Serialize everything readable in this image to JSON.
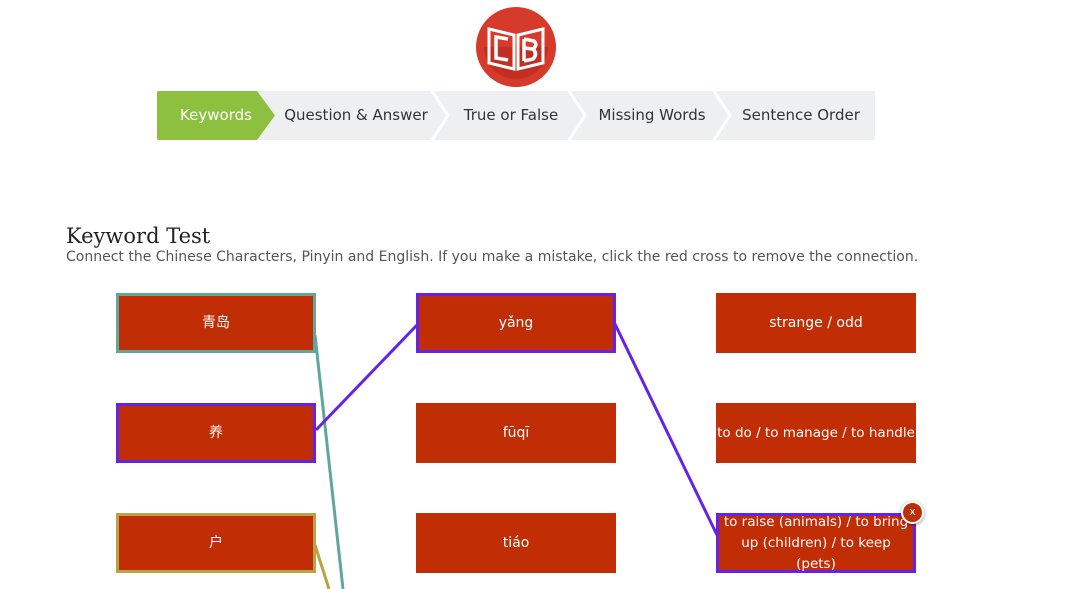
{
  "logo": {
    "icon": "cb-book-logo-icon",
    "color": "#d63a2b"
  },
  "steps": [
    {
      "label": "Keywords",
      "active": true
    },
    {
      "label": "Question & Answer",
      "active": false
    },
    {
      "label": "True or False",
      "active": false
    },
    {
      "label": "Missing Words",
      "active": false
    },
    {
      "label": "Sentence Order",
      "active": false
    }
  ],
  "test": {
    "title": "Keyword Test",
    "instructions": "Connect the Chinese Characters, Pinyin and English. If you make a mistake, click the red cross to remove the connection."
  },
  "columns": {
    "chinese": [
      "青岛",
      "养",
      "户"
    ],
    "pinyin": [
      "yǎng",
      "fūqī",
      "tiáo"
    ],
    "english": [
      "strange / odd",
      "to do / to manage / to handle",
      "to raise (animals) / to bring up (children) / to keep (pets)"
    ]
  },
  "remove_button": "x",
  "colors": {
    "card": "#c12d05",
    "active_step": "#8dc03f",
    "connection_teal": "#60a79b",
    "connection_purple": "#6424e7",
    "connection_olive": "#b9a345"
  }
}
